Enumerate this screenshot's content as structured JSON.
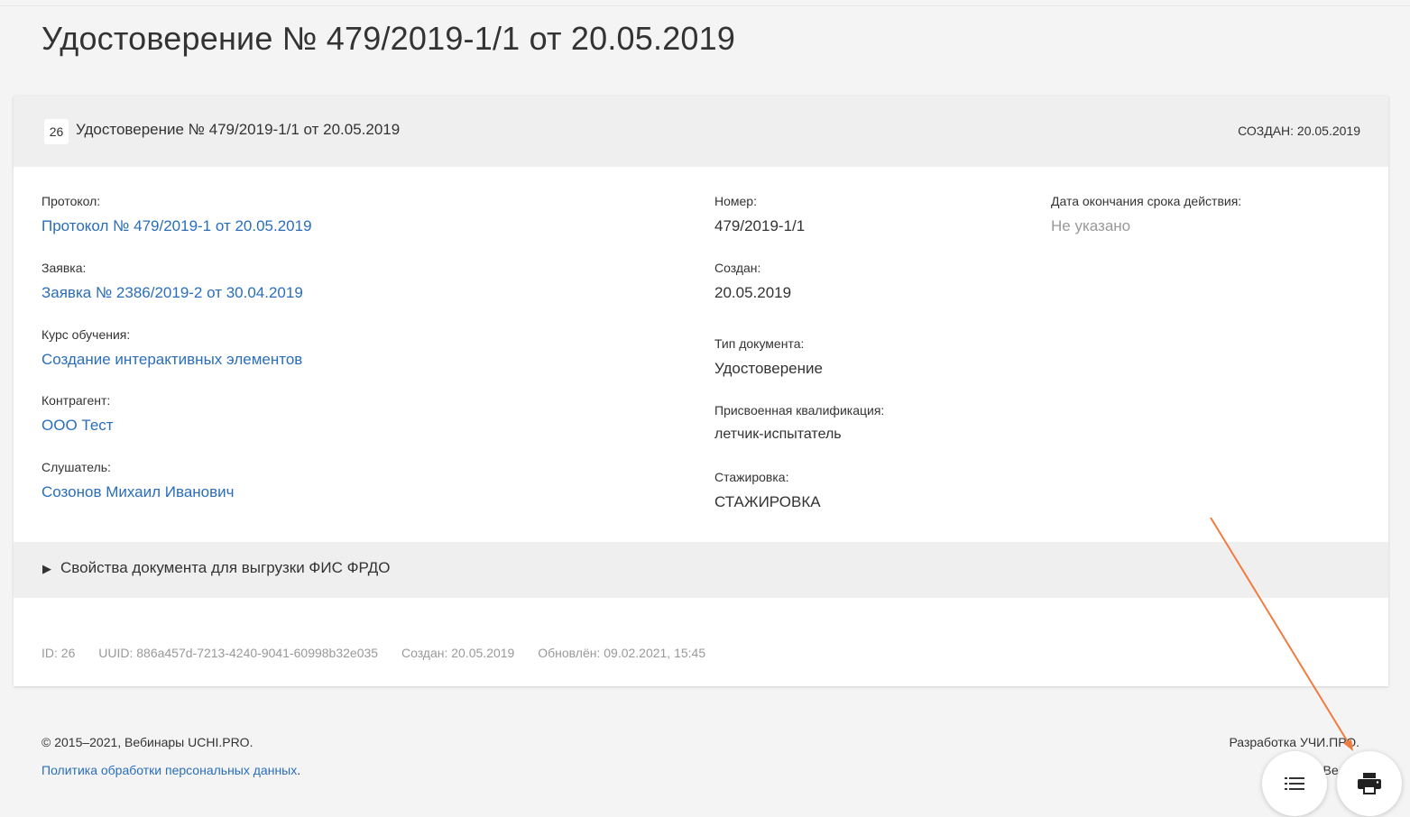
{
  "page": {
    "title": "Удостоверение № 479/2019-1/1 от 20.05.2019"
  },
  "card": {
    "id_badge": "26",
    "header_title": "Удостоверение № 479/2019-1/1 от 20.05.2019",
    "created_label": "СОЗДАН:",
    "created_value": "20.05.2019"
  },
  "left_fields": [
    {
      "label": "Протокол:",
      "value": "Протокол № 479/2019-1 от 20.05.2019"
    },
    {
      "label": "Заявка:",
      "value": "Заявка № 2386/2019-2 от 30.04.2019"
    },
    {
      "label": "Курс обучения:",
      "value": "Создание интерактивных элементов"
    },
    {
      "label": "Контрагент:",
      "value": "ООО Тест"
    },
    {
      "label": "Слушатель:",
      "value": "Созонов Михаил Иванович"
    }
  ],
  "middle_fields": [
    {
      "label": "Номер:",
      "value": "479/2019-1/1"
    },
    {
      "label": "Создан:",
      "value": "20.05.2019"
    },
    {
      "label": "Тип документа:",
      "value": "Удостоверение"
    },
    {
      "label": "Присвоенная квалификация:",
      "value": "летчик-испытатель"
    },
    {
      "label": "Стажировка:",
      "value": "СТАЖИРОВКА"
    }
  ],
  "right_fields": [
    {
      "label": "Дата окончания срока действия:",
      "value": "Не указано"
    }
  ],
  "properties_toggle": {
    "arrow": "▶",
    "label": "Свойства документа для выгрузки ФИС ФРДО"
  },
  "meta": {
    "id": "ID:  26",
    "uuid": "UUID:  886a457d-7213-4240-9041-60998b32e035",
    "created": "Создан:  20.05.2019",
    "updated": "Обновлён:  09.02.2021, 15:45"
  },
  "footer": {
    "copyright": "©  2015–2021, Вебинары UCHI.PRO.",
    "policy_link": "Политика обработки персональных данных",
    "policy_dot": ".",
    "developer": "Разработка УЧИ.ПРО.",
    "version": "Ве                  21."
  },
  "icons": {
    "list": "list-icon",
    "print": "printer-icon"
  },
  "colors": {
    "link": "#2a6ebb",
    "muted": "#999999",
    "annotation_arrow": "#f07b3f"
  }
}
